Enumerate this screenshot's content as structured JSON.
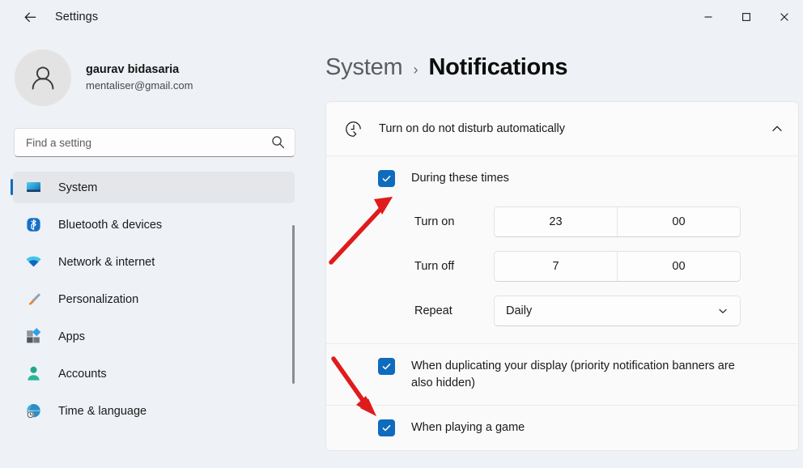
{
  "window": {
    "title": "Settings",
    "back_icon": "back-arrow-icon",
    "minimize_label": "—",
    "maximize_label": "□",
    "close_label": "✕"
  },
  "accent_color": "#0f6cbd",
  "annotation_color": "#e01b1b",
  "profile": {
    "name": "gaurav bidasaria",
    "email": "mentaliser@gmail.com",
    "avatar_icon": "person-avatar-icon"
  },
  "search": {
    "placeholder": "Find a setting",
    "value": "",
    "icon": "search-icon"
  },
  "sidebar": {
    "items": [
      {
        "label": "System",
        "icon": "monitor-icon",
        "selected": true
      },
      {
        "label": "Bluetooth & devices",
        "icon": "bluetooth-icon",
        "selected": false
      },
      {
        "label": "Network & internet",
        "icon": "wifi-icon",
        "selected": false
      },
      {
        "label": "Personalization",
        "icon": "paintbrush-icon",
        "selected": false
      },
      {
        "label": "Apps",
        "icon": "apps-grid-icon",
        "selected": false
      },
      {
        "label": "Accounts",
        "icon": "person-icon",
        "selected": false
      },
      {
        "label": "Time & language",
        "icon": "globe-clock-icon",
        "selected": false
      }
    ]
  },
  "breadcrumb": {
    "parent": "System",
    "separator": "›",
    "current": "Notifications"
  },
  "card": {
    "header_title": "Turn on do not disturb automatically",
    "header_icon": "clock-history-icon",
    "expand_icon": "chevron-up-icon",
    "expanded": true,
    "during_times": {
      "label": "During these times",
      "checked": true
    },
    "schedule": [
      {
        "label": "Turn on",
        "hour": "23",
        "minute": "00"
      },
      {
        "label": "Turn off",
        "hour": "7",
        "minute": "00"
      }
    ],
    "repeat": {
      "label": "Repeat",
      "value": "Daily",
      "icon": "chevron-down-icon"
    },
    "options": [
      {
        "label": "When duplicating your display (priority notification banners are also hidden)",
        "checked": true
      },
      {
        "label": "When playing a game",
        "checked": true
      }
    ]
  }
}
